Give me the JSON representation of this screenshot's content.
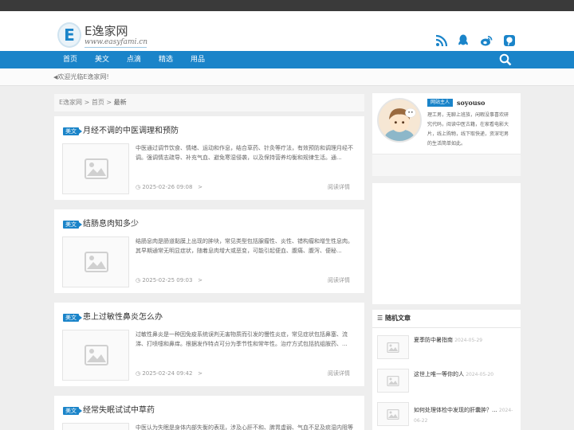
{
  "site": {
    "name": "E逸家网",
    "logo_letter": "E",
    "url_text": "www.easyfami.cn"
  },
  "social_icons": [
    "rss-icon",
    "qq-icon",
    "weibo-icon",
    "pinterest-icon"
  ],
  "nav": {
    "items": [
      "首页",
      "美文",
      "点滴",
      "精选",
      "用品"
    ]
  },
  "notice": "欢迎光临E逸家网!",
  "breadcrumb": {
    "site": "E逸家网",
    "sep": ">",
    "home": "首页",
    "current": "最新"
  },
  "posts": [
    {
      "tag": "美文",
      "title": "月经不调的中医调理和预防",
      "excerpt": "中医通过调节饮食、情绪、运动和作息，结合草药、针灸等疗法，有效预防和调理月经不调。强调情志疏导、补充气血、避免寒湿侵袭，以及保持营养均衡和规律生活。通...",
      "date": "2025-02-26 09:08",
      "read": "阅读详情"
    },
    {
      "tag": "美文",
      "title": "结肠息肉知多少",
      "excerpt": "结肠息肉是肠道黏膜上出现的肿块，常见类型包括腺瘤性、炎性、错构瘤和增生性息肉。其早期通常无明显症状，随着息肉增大或恶变，可能引起便血、腹痛、腹泻、便秘...",
      "date": "2025-02-25 09:03",
      "read": "阅读详情"
    },
    {
      "tag": "美文",
      "title": "患上过敏性鼻炎怎么办",
      "excerpt": "过敏性鼻炎是一种因免疫系统误判无害物质而引发的慢性炎症，常见症状包括鼻塞、流涕、打喷嚏和鼻痒。根据发作特点可分为季节性和常年性。治疗方式包括抗组胺药、...",
      "date": "2025-02-24 09:42",
      "read": "阅读详情"
    },
    {
      "tag": "美文",
      "title": "经常失眠试试中草药",
      "excerpt": "中医认为失眠是身体内部失衡的表现，涉及心肝不和、脾胃虚弱、气血不足及痰湿内阻等",
      "date": "",
      "read": ""
    }
  ],
  "profile": {
    "badge": "网站主人",
    "name": "soyouso",
    "bio": "理工男，无聊上班族，闲暇没事喜欢研究代码，阅读中医古籍，在家看电影大片，线上购物，线下取快递，资深宅男的生活简单如此。"
  },
  "random": {
    "title": "随机文章",
    "items": [
      {
        "title": "夏季防中暑指南",
        "date": "2024-05-29"
      },
      {
        "title": "这世上唯一等你的人",
        "date": "2024-05-20"
      },
      {
        "title": "如何处理体检中发现的肝囊肿？...",
        "date": "2024-06-22"
      }
    ]
  },
  "colors": {
    "accent": "#1a84c9",
    "topbar": "#3a3a3a",
    "background": "#eeeeee"
  }
}
